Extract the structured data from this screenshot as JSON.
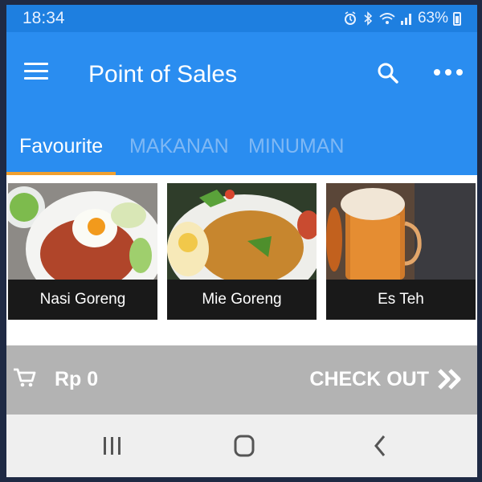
{
  "status_bar": {
    "time": "18:34",
    "battery_text": "63%",
    "icons": [
      "alarm-icon",
      "bluetooth-icon",
      "wifi-icon",
      "signal-icon",
      "battery-icon"
    ]
  },
  "app_bar": {
    "title": "Point of Sales",
    "menu_icon": "hamburger-menu-icon",
    "search_icon": "search-icon",
    "more_icon": "more-horizontal-icon"
  },
  "tabs": [
    {
      "label": "Favourite",
      "active": true
    },
    {
      "label": "MAKANAN",
      "active": false
    },
    {
      "label": "MINUMAN",
      "active": false
    }
  ],
  "products": [
    {
      "name": "Nasi Goreng"
    },
    {
      "name": "Mie Goreng"
    },
    {
      "name": "Es Teh"
    }
  ],
  "checkout_bar": {
    "total": "Rp 0",
    "button_label": "CHECK OUT",
    "cart_icon": "cart-icon",
    "arrow_icon": "double-chevron-right-icon"
  },
  "nav_bar": {
    "recents_icon": "recents-icon",
    "home_icon": "home-icon",
    "back_icon": "back-icon"
  },
  "colors": {
    "app_bar": "#2a8df0",
    "status_bar": "#1e7fe0",
    "tab_indicator": "#f0a030",
    "inactive_tab": "#7fb8f4",
    "checkout_bar": "#b3b3b3"
  }
}
